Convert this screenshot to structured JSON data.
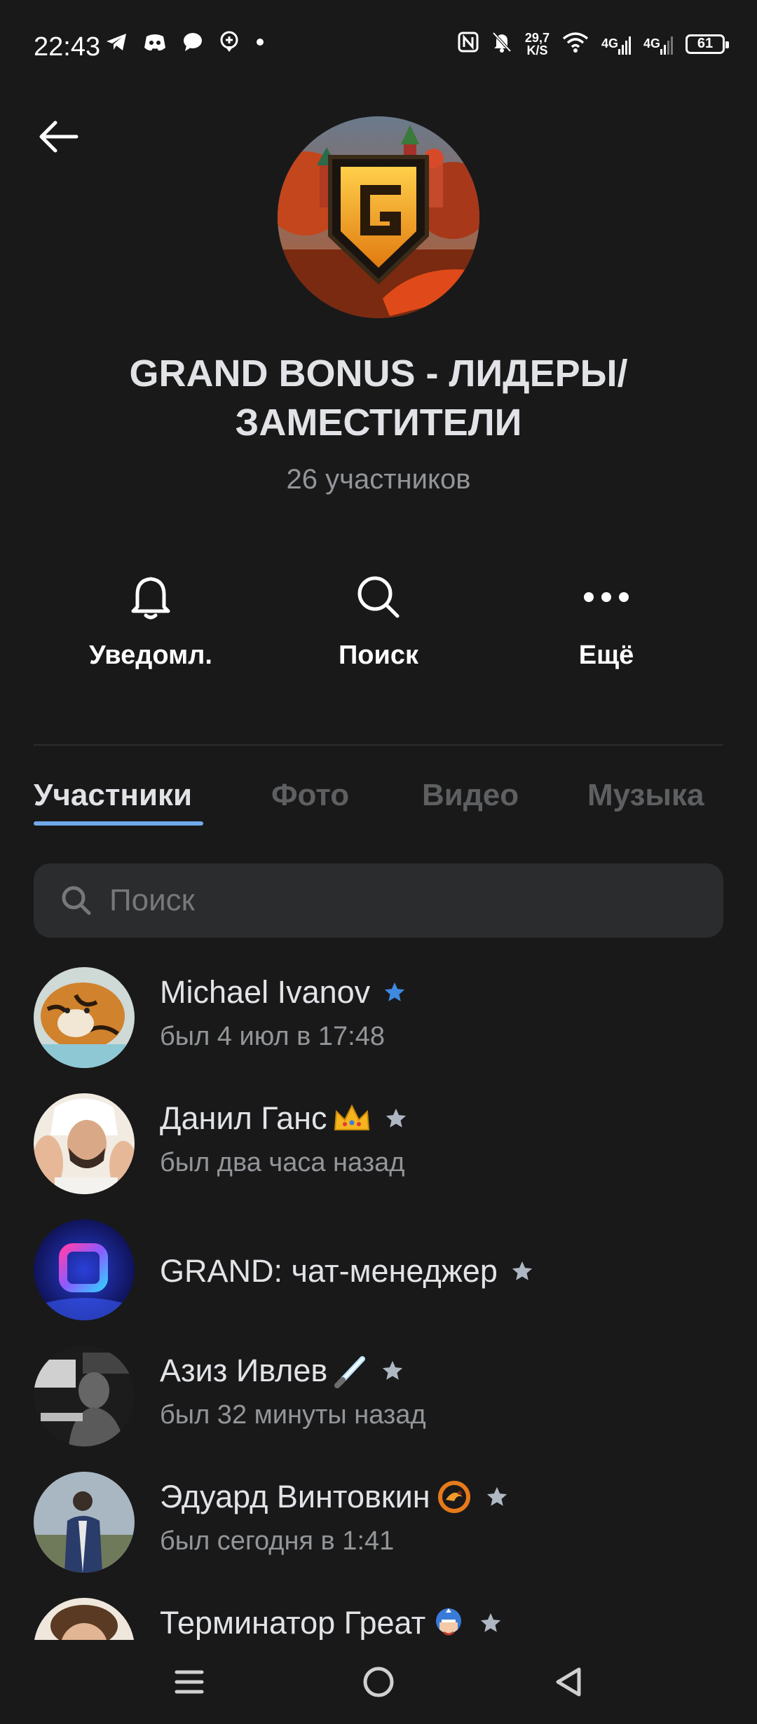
{
  "status_bar": {
    "time": "22:43",
    "net_speed_value": "29,7",
    "net_speed_unit": "K/S",
    "net_1": "4G",
    "net_2": "4G",
    "battery": "61"
  },
  "header": {
    "title": "GRAND BONUS - ЛИДЕРЫ/ ЗАМЕСТИТЕЛИ",
    "subtitle": "26 участников"
  },
  "actions": [
    {
      "label": "Уведомл.",
      "icon": "bell-icon"
    },
    {
      "label": "Поиск",
      "icon": "search-icon"
    },
    {
      "label": "Ещё",
      "icon": "more-icon"
    }
  ],
  "tabs": [
    {
      "label": "Участники",
      "active": true
    },
    {
      "label": "Фото",
      "active": false
    },
    {
      "label": "Видео",
      "active": false
    },
    {
      "label": "Музыка",
      "active": false
    }
  ],
  "search": {
    "placeholder": "Поиск"
  },
  "members": [
    {
      "name": "Michael Ivanov",
      "status": "был 4 июл в 17:48",
      "star_color": "#3f8ae0"
    },
    {
      "name": "Данил Ганс",
      "status": "был два часа назад",
      "emoji": "crown"
    },
    {
      "name": "GRAND: чат-менеджер",
      "status": ""
    },
    {
      "name": "Азиз Ивлев",
      "status": "был 32 минуты назад",
      "emoji": "lightsaber"
    },
    {
      "name": "Эдуард Винтовкин",
      "status": "был сегодня в 1:41",
      "emoji": "dragon"
    },
    {
      "name": "Терминатор Греат",
      "status": "",
      "emoji": "captain"
    }
  ],
  "colors": {
    "background": "#19191a",
    "accent": "#71aaeb",
    "admin_star": "#3f8ae0",
    "star": "#aeb7c2"
  }
}
